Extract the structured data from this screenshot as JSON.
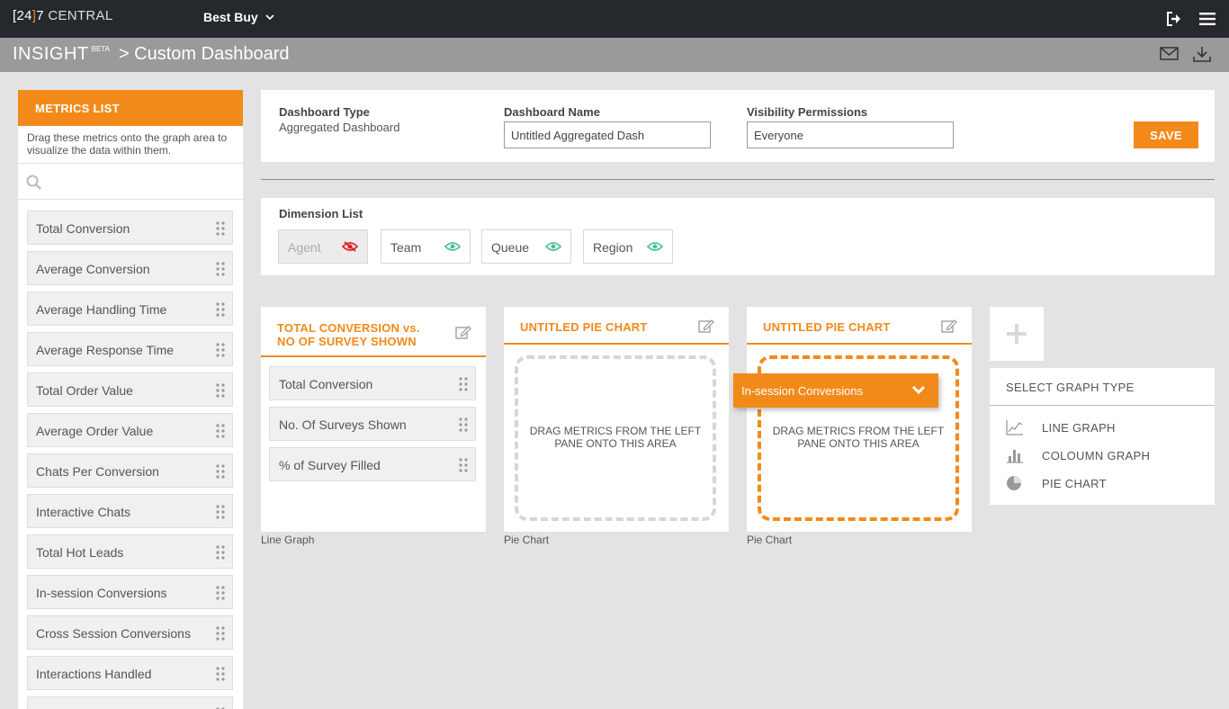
{
  "topbar": {
    "logo_bracket_open": "[",
    "logo_24": "24",
    "logo_bracket_close": "]",
    "logo_7": "7",
    "logo_central": " CENTRAL",
    "company": "Best Buy"
  },
  "subbar": {
    "insight": "INSIGHT",
    "beta": "BETA",
    "crumb": "> Custom Dashboard"
  },
  "metrics": {
    "header": "METRICS LIST",
    "description": "Drag these metrics onto the graph area to visualize the data within them.",
    "search_value": "",
    "items": [
      "Total Conversion",
      "Average Conversion",
      "Average Handling Time",
      "Average Response Time",
      "Total Order Value",
      "Average Order Value",
      "Chats Per Conversion",
      "Interactive Chats",
      "Total Hot Leads",
      "In-session Conversions",
      "Cross Session Conversions",
      "Interactions Handled"
    ]
  },
  "config": {
    "type_label": "Dashboard Type",
    "type_value": "Aggregated Dashboard",
    "name_label": "Dashboard Name",
    "name_value": "Untitled Aggregated Dash",
    "visibility_label": "Visibility Permissions",
    "visibility_value": "Everyone",
    "save_label": "SAVE"
  },
  "dimensions": {
    "title": "Dimension List",
    "items": [
      {
        "label": "Agent",
        "visible": false
      },
      {
        "label": "Team",
        "visible": true
      },
      {
        "label": "Queue",
        "visible": true
      },
      {
        "label": "Region",
        "visible": true
      }
    ]
  },
  "graphs": [
    {
      "title_line1": "TOTAL CONVERSION vs.",
      "title_line2": "NO OF SURVEY SHOWN",
      "metrics": [
        "Total Conversion",
        "No. Of Surveys Shown",
        "% of Survey Filled"
      ],
      "caption": "Line Graph"
    },
    {
      "title_line1": "UNTITLED PIE CHART",
      "drop_text": "DRAG METRICS FROM THE LEFT PANE ONTO THIS AREA",
      "caption": "Pie Chart"
    },
    {
      "title_line1": "UNTITLED PIE CHART",
      "drop_text": "DRAG METRICS FROM THE LEFT PANE ONTO THIS AREA",
      "caption": "Pie Chart"
    }
  ],
  "dragging": {
    "label": "In-session Conversions"
  },
  "graph_types": {
    "header": "SELECT GRAPH TYPE",
    "items": [
      "LINE GRAPH",
      "COLOUMN GRAPH",
      "PIE CHART"
    ]
  },
  "colors": {
    "accent": "#f28a1a",
    "topbar": "#25292e",
    "subbar": "#9a9a9a",
    "eye_visible": "#4bbf9a",
    "eye_hidden": "#e02020"
  }
}
